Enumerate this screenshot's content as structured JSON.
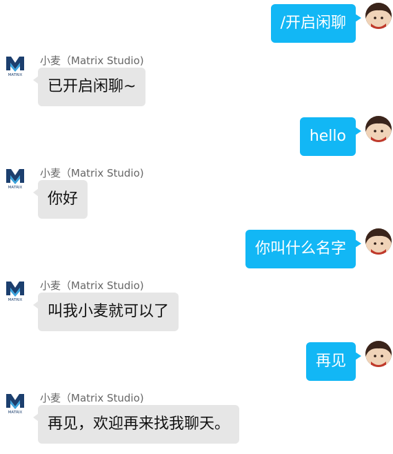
{
  "colors": {
    "user_bubble": "#12b7f5",
    "bot_bubble": "#e6e6e6",
    "brand": "#1c3f6e",
    "brand_light": "#3aa3dd"
  },
  "bot": {
    "name": "小麦（Matrix Studio)",
    "logo_text": "MATRIX",
    "logo_icon": "matrix-logo-icon"
  },
  "user": {
    "avatar_icon": "user-avatar-icon"
  },
  "messages": [
    {
      "from": "user",
      "text": "/开启闲聊"
    },
    {
      "from": "bot",
      "text": "已开启闲聊~"
    },
    {
      "from": "user",
      "text": "hello"
    },
    {
      "from": "bot",
      "text": "你好"
    },
    {
      "from": "user",
      "text": "你叫什么名字"
    },
    {
      "from": "bot",
      "text": "叫我小麦就可以了"
    },
    {
      "from": "user",
      "text": "再见"
    },
    {
      "from": "bot",
      "text": "再见，欢迎再来找我聊天。"
    }
  ]
}
